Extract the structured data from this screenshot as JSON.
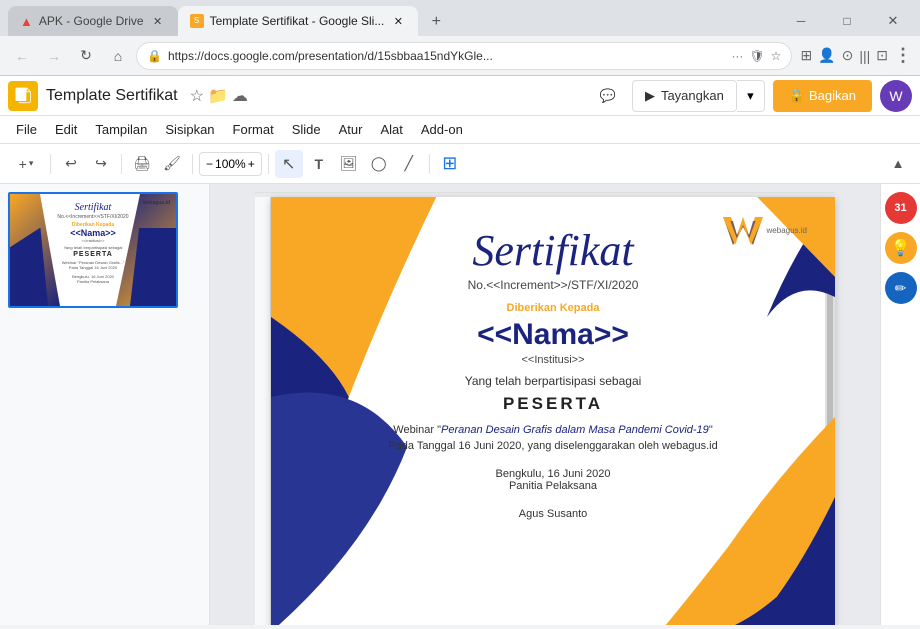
{
  "browser": {
    "tabs": [
      {
        "id": "tab1",
        "label": "APK - Google Drive",
        "favicon": "drive",
        "active": false
      },
      {
        "id": "tab2",
        "label": "Template Sertifikat - Google Sli...",
        "favicon": "slides",
        "active": true
      }
    ],
    "address": "https://docs.google.com/presentation/d/15sbbaa15ndYkGle...",
    "new_tab_label": "+"
  },
  "app": {
    "title": "Template Sertifikat",
    "menu": {
      "items": [
        "File",
        "Edit",
        "Tampilan",
        "Sisipkan",
        "Format",
        "Slide",
        "Atur",
        "Alat",
        "Add-on"
      ]
    },
    "toolbar": {
      "zoom": "100%",
      "tools": [
        "select",
        "text",
        "image",
        "shape",
        "line"
      ]
    },
    "header_right": {
      "present_label": "Tayangkan",
      "share_label": "Bagikan",
      "user_initial": "W"
    }
  },
  "certificate": {
    "title": "Sertifikat",
    "subtitle": "No.<<Increment>>/STF/XI/2020",
    "diberikan_label": "Diberikan Kepada",
    "name": "<<Nama>>",
    "institusi": "<<Institusi>>",
    "yang_label": "Yang telah berpartisipasi sebagai",
    "role": "PESERTA",
    "webinar_pre": "Webinar \"",
    "webinar_title": "Peranan Desain Grafis dalam Masa Pandemi Covid-19",
    "webinar_post": "\"",
    "tanggal": "Pada Tanggal 16 Juni 2020, yang diselenggarakan oleh webagus.id",
    "location_date": "Bengkulu, 16 Juni 2020",
    "committee": "Panitia Pelaksana",
    "signee": "Agus Susanto",
    "logo": "webagus.id"
  },
  "sidebar_icons": {
    "calendar": "31",
    "idea": "💡",
    "edit": "✏️"
  }
}
